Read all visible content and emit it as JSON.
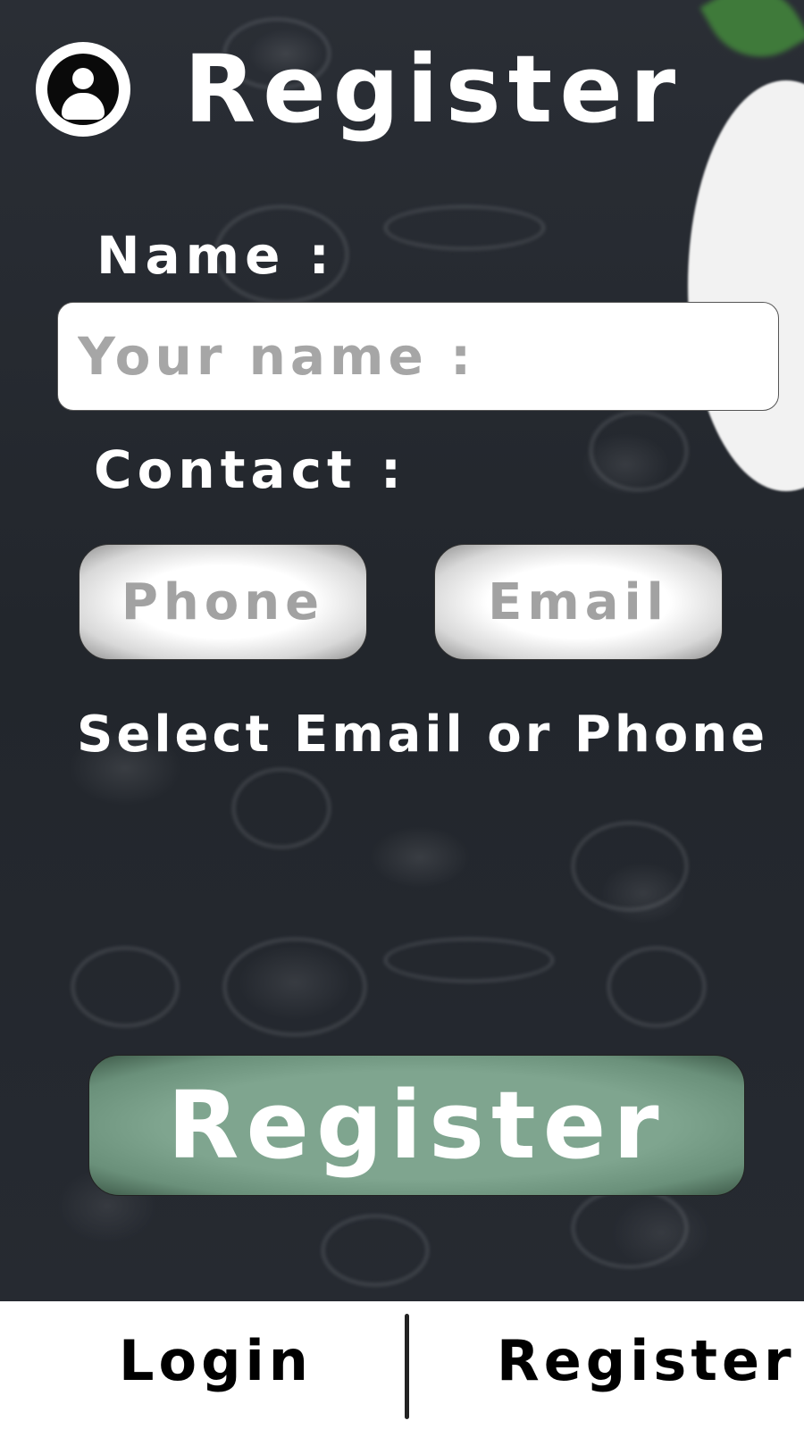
{
  "header": {
    "title": "Register",
    "icon": "account-circle-icon"
  },
  "form": {
    "name_label": "Name :",
    "name_placeholder": "Your name :",
    "contact_label": "Contact :",
    "phone_label": "Phone",
    "email_label": "Email",
    "hint": "Select Email or Phone",
    "submit_label": "Register"
  },
  "nav": {
    "login": "Login",
    "register": "Register"
  },
  "colors": {
    "submit_button": "#7fa58f",
    "background": "#23272d",
    "nav_background": "#ffffff"
  }
}
